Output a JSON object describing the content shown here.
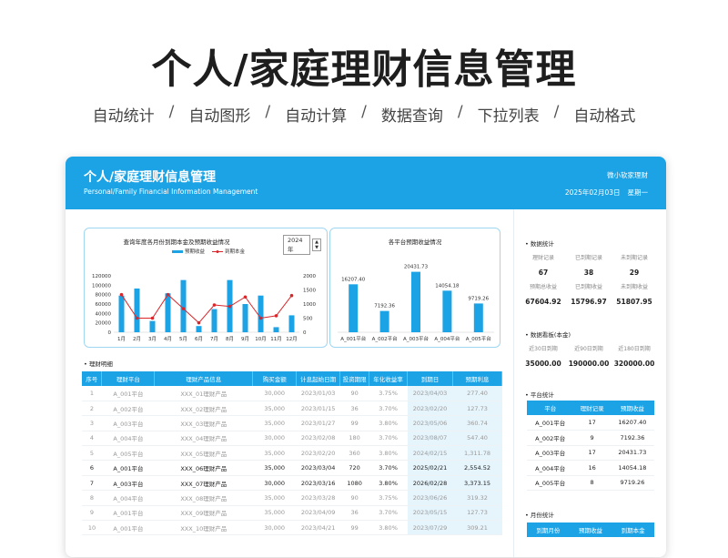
{
  "hero": {
    "title": "个人/家庭理财信息管理",
    "features": [
      "自动统计",
      "自动图形",
      "自动计算",
      "数据查询",
      "下拉列表",
      "自动格式"
    ]
  },
  "header": {
    "title": "个人/家庭理财信息管理",
    "subtitle": "Personal/Family Financial Information Management",
    "brand": "微小软家理财",
    "date": "2025年02月03日",
    "weekday": "星期一"
  },
  "chart1": {
    "title": "查询年度各月份到期本金及预期收益情况",
    "year": "2024 年",
    "legend_bar": "预期收益",
    "legend_line": "到期本金"
  },
  "chart2": {
    "title": "各平台预期收益情况"
  },
  "chart_data": [
    {
      "type": "bar",
      "categories": [
        "1月",
        "2月",
        "3月",
        "4月",
        "5月",
        "6月",
        "7月",
        "8月",
        "9月",
        "10月",
        "11月",
        "12月"
      ],
      "series": [
        {
          "name": "预期收益",
          "type": "bar",
          "axis": "right",
          "values": [
            1300,
            1550,
            400,
            1380,
            1850,
            220,
            820,
            1850,
            1000,
            1300,
            180,
            600
          ]
        },
        {
          "name": "到期本金",
          "type": "line",
          "axis": "left",
          "values": [
            80000,
            30000,
            30000,
            80000,
            50000,
            20000,
            58000,
            55000,
            75000,
            30000,
            35000,
            78000
          ]
        }
      ],
      "yticks_left": [
        "0",
        "20000",
        "40000",
        "60000",
        "80000",
        "100000",
        "120000"
      ],
      "yticks_right": [
        "0",
        "500",
        "1000",
        "1500",
        "2000"
      ],
      "ylim_left": [
        0,
        120000
      ],
      "ylim_right": [
        0,
        2000
      ],
      "legend": "top-center",
      "colors": {
        "bar": "#1ba3e6",
        "line": "#d9262b"
      }
    },
    {
      "type": "bar",
      "categories": [
        "A_001平台",
        "A_002平台",
        "A_003平台",
        "A_004平台",
        "A_005平台"
      ],
      "values": [
        16207.4,
        7192.36,
        20431.73,
        14054.18,
        9719.26
      ],
      "labels": [
        "16207.40",
        "7192.36",
        "20431.73",
        "14054.18",
        "9719.26"
      ],
      "ylim": [
        0,
        24000
      ],
      "colors": {
        "bar": "#1ba3e6"
      }
    }
  ],
  "detail": {
    "label": "理财明细",
    "columns": [
      "序号",
      "理财平台",
      "理财产品信息",
      "购买金额",
      "计息起始日期",
      "投资期限",
      "年化收益率",
      "到期日",
      "预期利息"
    ],
    "rows": [
      {
        "cells": [
          "1",
          "A_001平台",
          "XXX_01理财产品",
          "30,000",
          "2023/01/03",
          "90",
          "3.75%",
          "2023/04/03",
          "277.40"
        ],
        "bold": false
      },
      {
        "cells": [
          "2",
          "A_002平台",
          "XXX_02理财产品",
          "35,000",
          "2023/01/15",
          "36",
          "3.70%",
          "2023/02/20",
          "127.73"
        ],
        "bold": false
      },
      {
        "cells": [
          "3",
          "A_003平台",
          "XXX_03理财产品",
          "35,000",
          "2023/01/27",
          "99",
          "3.80%",
          "2023/05/06",
          "360.74"
        ],
        "bold": false
      },
      {
        "cells": [
          "4",
          "A_004平台",
          "XXX_04理财产品",
          "30,000",
          "2023/02/08",
          "180",
          "3.70%",
          "2023/08/07",
          "547.40"
        ],
        "bold": false
      },
      {
        "cells": [
          "5",
          "A_005平台",
          "XXX_05理财产品",
          "35,000",
          "2023/02/20",
          "360",
          "3.80%",
          "2024/02/15",
          "1,311.78"
        ],
        "bold": false
      },
      {
        "cells": [
          "6",
          "A_001平台",
          "XXX_06理财产品",
          "35,000",
          "2023/03/04",
          "720",
          "3.70%",
          "2025/02/21",
          "2,554.52"
        ],
        "bold": true
      },
      {
        "cells": [
          "7",
          "A_003平台",
          "XXX_07理财产品",
          "30,000",
          "2023/03/16",
          "1080",
          "3.80%",
          "2026/02/28",
          "3,373.15"
        ],
        "bold": true
      },
      {
        "cells": [
          "8",
          "A_004平台",
          "XXX_08理财产品",
          "35,000",
          "2023/03/28",
          "90",
          "3.75%",
          "2023/06/26",
          "319.32"
        ],
        "bold": false
      },
      {
        "cells": [
          "9",
          "A_001平台",
          "XXX_09理财产品",
          "35,000",
          "2023/04/09",
          "36",
          "3.70%",
          "2023/05/15",
          "127.73"
        ],
        "bold": false
      },
      {
        "cells": [
          "10",
          "A_001平台",
          "XXX_10理财产品",
          "30,000",
          "2023/04/21",
          "99",
          "3.80%",
          "2023/07/29",
          "309.21"
        ],
        "bold": false
      }
    ]
  },
  "stats": {
    "label": "数据统计",
    "items": [
      {
        "k": "理财记录",
        "v": "67"
      },
      {
        "k": "已到期记录",
        "v": "38"
      },
      {
        "k": "未到期记录",
        "v": "29"
      },
      {
        "k": "预期总收益",
        "v": "67604.92"
      },
      {
        "k": "已到期收益",
        "v": "15796.97"
      },
      {
        "k": "未到期收益",
        "v": "51807.95"
      }
    ]
  },
  "board": {
    "label": "数据看板(本金)",
    "items": [
      {
        "k": "近30日到期",
        "v": "35000.00"
      },
      {
        "k": "近90日到期",
        "v": "190000.00"
      },
      {
        "k": "近180日到期",
        "v": "320000.00"
      }
    ]
  },
  "platform": {
    "label": "平台统计",
    "columns": [
      "平台",
      "理财记录",
      "预期收益"
    ],
    "rows": [
      [
        "A_001平台",
        "17",
        "16207.40"
      ],
      [
        "A_002平台",
        "9",
        "7192.36"
      ],
      [
        "A_003平台",
        "17",
        "20431.73"
      ],
      [
        "A_004平台",
        "16",
        "14054.18"
      ],
      [
        "A_005平台",
        "8",
        "9719.26"
      ]
    ]
  },
  "monthly": {
    "label": "月份统计",
    "columns": [
      "到期月份",
      "预期收益",
      "到期本金"
    ]
  }
}
